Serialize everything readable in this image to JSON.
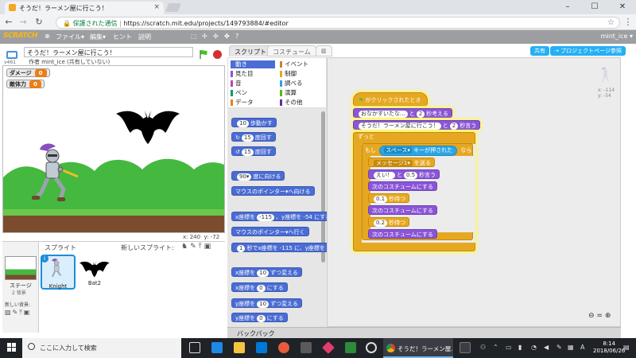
{
  "browser": {
    "tab_title": "そうだ！ラーメン屋に行こう！",
    "secure_label": "保護された通信",
    "url": "https://scratch.mit.edu/projects/149793884/#editor"
  },
  "menubar": {
    "logo": "SCRATCH",
    "file": "ファイル▾",
    "edit": "編集▾",
    "hint": "ヒント",
    "about": "説明",
    "user": "mint_ice ▾"
  },
  "stage_header": {
    "version": "v461",
    "project_title": "そうだ！ラーメン屋に行こう！",
    "author": "作者 mint_ice (共有していない)"
  },
  "variables": [
    {
      "label": "ダメージ",
      "value": "0"
    },
    {
      "label": "敵体力",
      "value": "0"
    }
  ],
  "stage_coords": {
    "x": "x: 240",
    "y": "y: -72"
  },
  "sprites": {
    "title": "スプライト",
    "new_sprite": "新しいスプライト:",
    "stage_label": "ステージ",
    "stage_sub": "2 背景",
    "new_backdrop": "新しい背景:",
    "items": [
      {
        "name": "Knight"
      },
      {
        "name": "Bat2"
      }
    ]
  },
  "palette": {
    "tabs": [
      "スクリプト",
      "コスチューム",
      "音"
    ],
    "categories": [
      {
        "label": "動き",
        "color": "#4a6cd4"
      },
      {
        "label": "イベント",
        "color": "#c88330"
      },
      {
        "label": "見た目",
        "color": "#8a55d7"
      },
      {
        "label": "制御",
        "color": "#e1a91a"
      },
      {
        "label": "音",
        "color": "#bb42c3"
      },
      {
        "label": "調べる",
        "color": "#2ca5e2"
      },
      {
        "label": "ペン",
        "color": "#0e9a6c"
      },
      {
        "label": "演算",
        "color": "#5cb712"
      },
      {
        "label": "データ",
        "color": "#ee7d16"
      },
      {
        "label": "その他",
        "color": "#632d99"
      }
    ],
    "blocks": [
      {
        "pre": "",
        "arg": "10",
        "post": "歩動かす"
      },
      {
        "pre": "↻",
        "arg": "15",
        "post": "度回す"
      },
      {
        "pre": "↺",
        "arg": "15",
        "post": "度回す"
      },
      {
        "pre": "",
        "arg": "90▾",
        "post": "度に向ける"
      },
      {
        "pre": "マウスのポインター▾",
        "arg": "",
        "post": "へ向ける"
      },
      {
        "pre": "x座標を",
        "arg": "-115",
        "post": "、y座標を -54 にする"
      },
      {
        "pre": "マウスのポインター▾",
        "arg": "",
        "post": "へ行く"
      },
      {
        "pre": "",
        "arg": "1",
        "post": "秒でx座標を -115 に、y座標を"
      },
      {
        "pre": "x座標を",
        "arg": "10",
        "post": "ずつ変える"
      },
      {
        "pre": "x座標を",
        "arg": "0",
        "post": "にする"
      },
      {
        "pre": "y座標を",
        "arg": "10",
        "post": "ずつ変える"
      },
      {
        "pre": "y座標を",
        "arg": "0",
        "post": "にする"
      }
    ]
  },
  "top_buttons": {
    "share": "共有",
    "project_page": "プロジェクトページ参照"
  },
  "sprite_info": {
    "x": "x: -114",
    "y": "y: -54"
  },
  "script": {
    "hat": "がクリックされたとき",
    "think_pre": "おなかすいたな...",
    "think_mid": "と",
    "think_arg": "2",
    "think_post": "秒考える",
    "say_pre": "そうだ！ラーメン屋に行こう！",
    "say_mid": "と",
    "say_arg": "2",
    "say_post": "秒言う",
    "forever": "ずっと",
    "if_pre": "もし",
    "if_key": "スペース▾",
    "if_mid": "キーが押された",
    "if_post": "なら",
    "broadcast": "メッセージ1▾",
    "broadcast_post": "を送る",
    "say2_arg1": "えい！",
    "say2_mid": "と",
    "say2_arg2": "0.5",
    "say2_post": "秒言う",
    "next1": "次のコスチュームにする",
    "wait1_arg": "0.1",
    "wait_post": "秒待つ",
    "next2": "次のコスチュームにする",
    "wait2_arg": "0.2",
    "next3": "次のコスチュームにする"
  },
  "backpack": "バックパック",
  "taskbar": {
    "search": "ここに入力して検索",
    "chrome_task": "そうだ！ラーメン屋...",
    "time": "8:14",
    "date": "2018/06/26"
  }
}
